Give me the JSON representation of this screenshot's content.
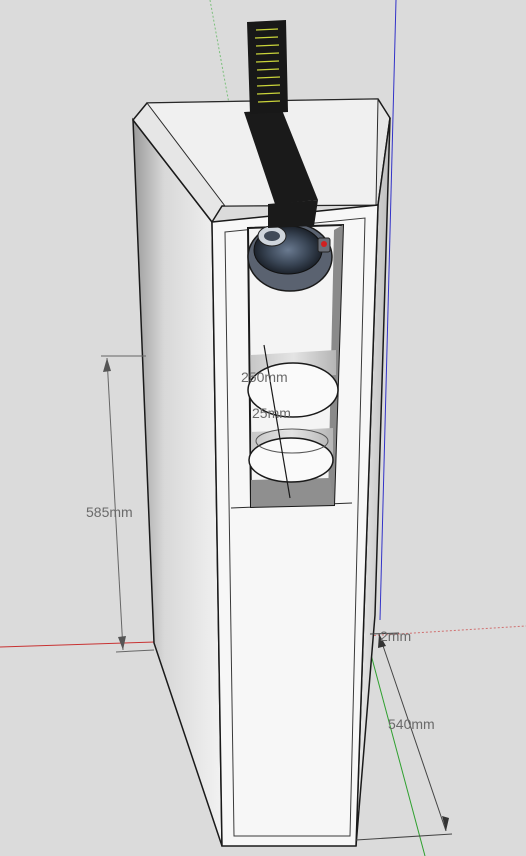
{
  "model": {
    "type": "3d-cad-model",
    "subject": "speaker-cabinet",
    "background_color": "#dbdbdb",
    "axis_colors": {
      "red": "#c83232",
      "green": "#2ea02e",
      "blue": "#3232c8"
    }
  },
  "dimensions": {
    "height_label": "585mm",
    "depth_label": "540mm",
    "small_label": "2mm",
    "port_diameter_label": "250mm",
    "port_inner_label": "25mm"
  }
}
